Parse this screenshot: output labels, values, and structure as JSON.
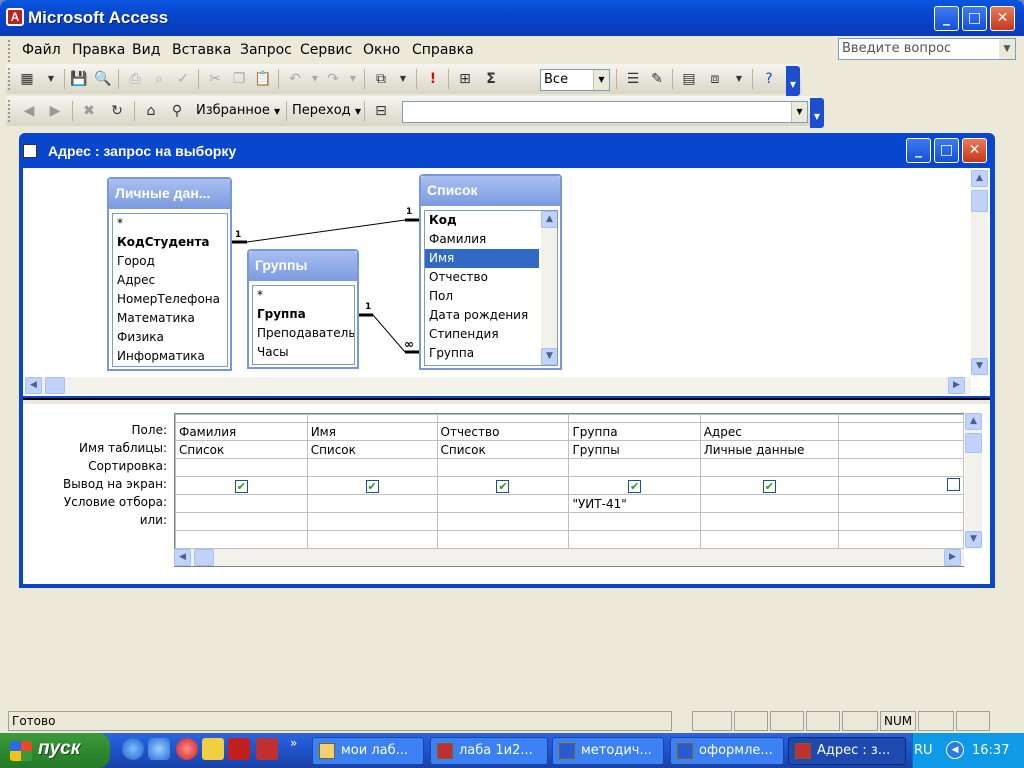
{
  "app": {
    "title": "Microsoft Access"
  },
  "menu": {
    "items": [
      "Файл",
      "Правка",
      "Вид",
      "Вставка",
      "Запрос",
      "Сервис",
      "Окно",
      "Справка"
    ],
    "ask_placeholder": "Введите вопрос"
  },
  "toolbar1": {
    "combo_value": "Все"
  },
  "toolbar2": {
    "favorites": "Избранное",
    "goto": "Переход",
    "address_value": ""
  },
  "query_window": {
    "title": "Адрес : запрос на выборку"
  },
  "tables": [
    {
      "title": "Личные дан...",
      "fields": [
        "*",
        "КодСтудента",
        "Город",
        "Адрес",
        "НомерТелефона",
        "Математика",
        "Физика",
        "Информатика"
      ]
    },
    {
      "title": "Группы",
      "fields": [
        "*",
        "Группа",
        "Преподаватель",
        "Часы"
      ]
    },
    {
      "title": "Список",
      "fields": [
        "Код",
        "Фамилия",
        "Имя",
        "Отчество",
        "Пол",
        "Дата рождения",
        "Стипендия",
        "Группа"
      ]
    }
  ],
  "relations": {
    "one": "1",
    "many": "∞"
  },
  "grid": {
    "row_labels": [
      "Поле:",
      "Имя таблицы:",
      "Сортировка:",
      "Вывод на экран:",
      "Условие отбора:",
      "или:"
    ],
    "columns": [
      {
        "field": "Фамилия",
        "table": "Список",
        "sort": "",
        "show": true,
        "criteria": ""
      },
      {
        "field": "Имя",
        "table": "Список",
        "sort": "",
        "show": true,
        "criteria": ""
      },
      {
        "field": "Отчество",
        "table": "Список",
        "sort": "",
        "show": true,
        "criteria": ""
      },
      {
        "field": "Группа",
        "table": "Группы",
        "sort": "",
        "show": true,
        "criteria": "\"УИТ-41\""
      },
      {
        "field": "Адрес",
        "table": "Личные данные",
        "sort": "",
        "show": true,
        "criteria": ""
      }
    ]
  },
  "status": {
    "text": "Готово",
    "num": "NUM"
  },
  "taskbar": {
    "start": "пуск",
    "tasks": [
      "мои лаб...",
      "лаба 1и2...",
      "методич...",
      "оформле...",
      "Адрес : з..."
    ],
    "lang": "RU",
    "clock": "16:37",
    "more": "»"
  },
  "icons": {
    "check": "✔",
    "up": "▲",
    "down": "▼",
    "left": "◀",
    "right": "▶"
  }
}
